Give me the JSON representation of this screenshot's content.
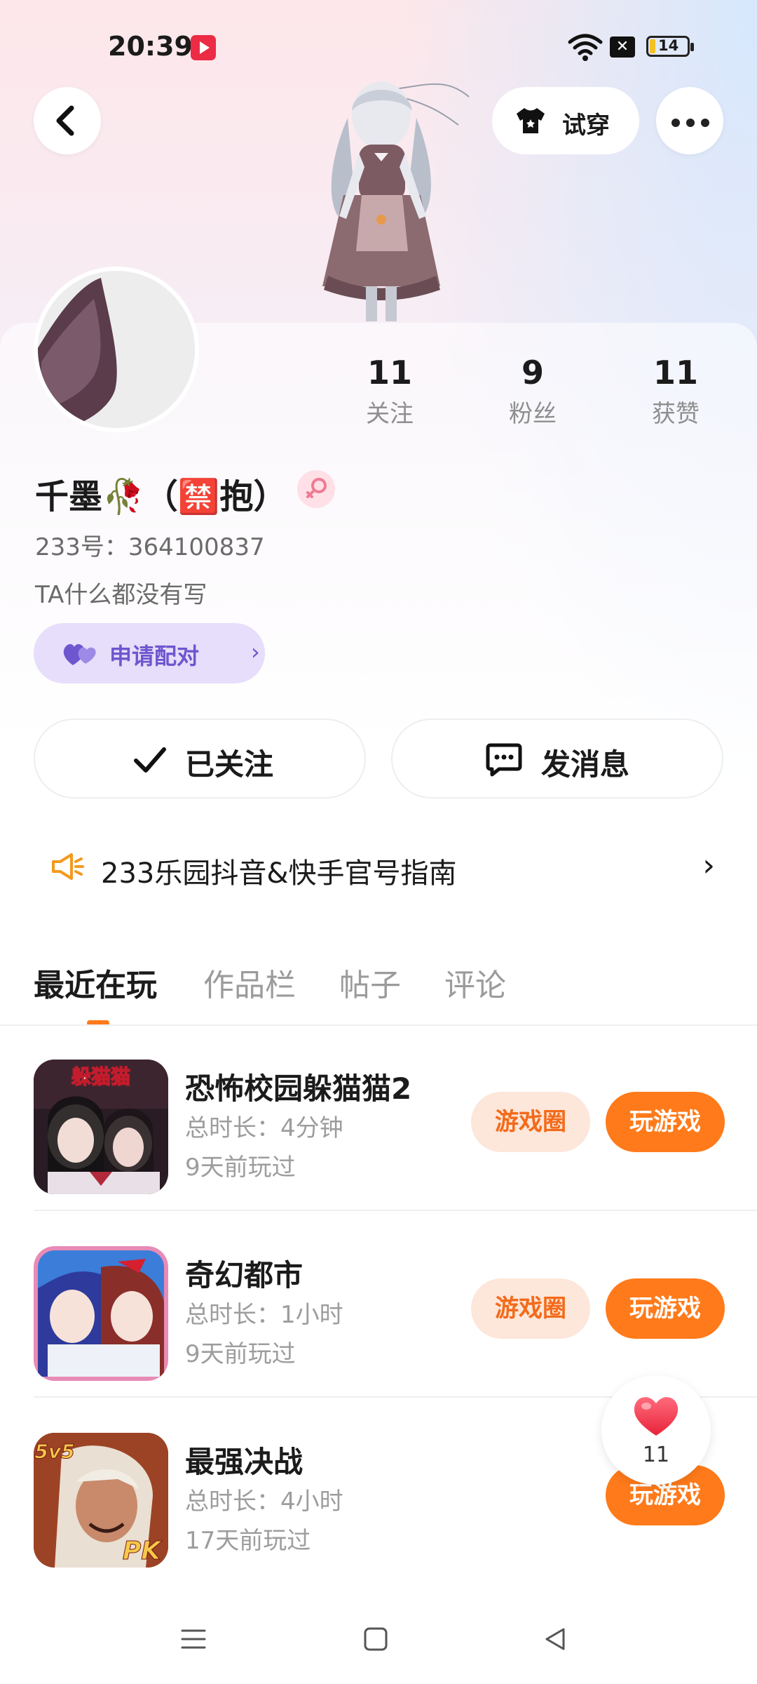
{
  "status_bar": {
    "time": "20:39",
    "battery": "14"
  },
  "header": {
    "try_on_label": "试穿"
  },
  "profile": {
    "stats": [
      {
        "value": "11",
        "label": "关注"
      },
      {
        "value": "9",
        "label": "粉丝"
      },
      {
        "value": "11",
        "label": "获赞"
      }
    ],
    "name": "千墨🥀（🈲抱）",
    "uid": "233号：364100837",
    "bio": "TA什么都没有写",
    "pair_label": "申请配对",
    "followed_label": "已关注",
    "message_label": "发消息"
  },
  "notice": {
    "text": "233乐园抖音&快手官号指南"
  },
  "tabs": [
    "最近在玩",
    "作品栏",
    "帖子",
    "评论"
  ],
  "games": [
    {
      "title": "恐怖校园躲猫猫2",
      "duration": "总时长：4分钟",
      "last_played": "9天前玩过",
      "circle_label": "游戏圈",
      "play_label": "玩游戏"
    },
    {
      "title": "奇幻都市",
      "duration": "总时长：1小时",
      "last_played": "9天前玩过",
      "circle_label": "游戏圈",
      "play_label": "玩游戏"
    },
    {
      "title": "最强决战",
      "duration": "总时长：4小时",
      "last_played": "17天前玩过",
      "play_label": "玩游戏"
    }
  ],
  "thumb_labels": {
    "game1": "躲猫猫",
    "game3_top": "5v5",
    "game3_bottom": "PK"
  },
  "like_fab": {
    "count": "11"
  },
  "colors": {
    "accent": "#ff7a1a",
    "pair_purple": "#6e56cf",
    "heart_red": "#f23a4c"
  }
}
